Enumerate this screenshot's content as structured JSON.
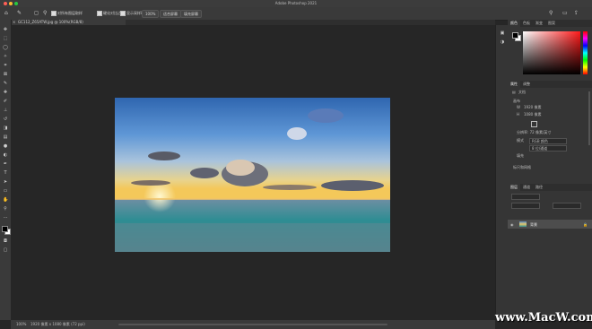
{
  "window": {
    "title": "Adobe Photoshop 2021"
  },
  "options_bar": {
    "item1": "对所有图层取样",
    "item2": "硬化对比边缘",
    "item3": "显示采样环",
    "zoom_value": "100%",
    "fit_button": "适合屏幕",
    "fill_button": "填充屏幕"
  },
  "document_tab": {
    "label": "GC112_Z65ATW.jpg @ 100%(RGB/8)"
  },
  "status_bar": {
    "zoom": "100%",
    "info": "1920 像素 x 1080 像素 (72 ppi)"
  },
  "panels": {
    "color_tabs": [
      "颜色",
      "色板",
      "渐变",
      "图案"
    ],
    "properties_tabs": [
      "属性",
      "调整"
    ],
    "properties": {
      "doc_label": "文档",
      "canvas_section": "画布",
      "width_label": "W",
      "width_value": "1920 像素",
      "height_label": "H",
      "height_value": "1080 像素",
      "resolution": "分辨率: 72 像素/英寸",
      "mode_label": "模式",
      "mode_value": "RGB 颜色",
      "depth_value": "8 位/通道",
      "fill_label": "填充",
      "guides_section": "标尺和网格"
    },
    "layers_tabs": [
      "图层",
      "通道",
      "路径"
    ],
    "layer": {
      "name": "背景"
    }
  },
  "watermark": {
    "text": "www.MacW.com"
  },
  "colors": {
    "fg": "#000000",
    "bg": "#ffffff",
    "picker_hue": "#ff1a1a"
  }
}
